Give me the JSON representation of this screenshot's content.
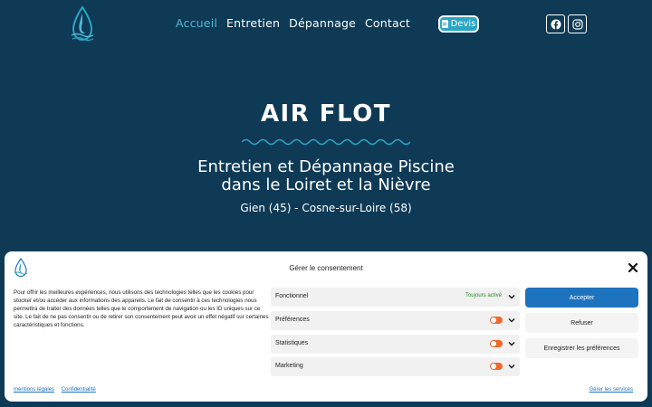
{
  "nav": {
    "items": [
      {
        "label": "Accueil",
        "active": true
      },
      {
        "label": "Entretien",
        "active": false
      },
      {
        "label": "Dépannage",
        "active": false
      },
      {
        "label": "Contact",
        "active": false
      }
    ],
    "devis_label": "Devis",
    "active_color": "#4fb8d4"
  },
  "hero": {
    "title": "AIR FLOT",
    "subtitle_line1": "Entretien et Dépannage Piscine",
    "subtitle_line2": "dans le Loiret et la Nièvre",
    "locations": "Gien (45) - Cosne-sur-Loire (58)"
  },
  "consent": {
    "title": "Gérer le consentement",
    "description": "Pour offrir les meilleures expériences, nous utilisons des technologies telles que les cookies pour stocker et/ou accéder aux informations des appareils. Le fait de consentir à ces technologies nous permettra de traiter des données telles que le comportement de navigation ou les ID uniques sur ce site. Le fait de ne pas consentir ou de retirer son consentement peut avoir un effet négatif sur certaines caractéristiques et fonctions.",
    "categories": [
      {
        "label": "Fonctionnel",
        "status": "Toujours activé"
      },
      {
        "label": "Préférences",
        "status": ""
      },
      {
        "label": "Statistiques",
        "status": ""
      },
      {
        "label": "Marketing",
        "status": ""
      }
    ],
    "accept_label": "Accepter",
    "refuse_label": "Refuser",
    "save_prefs_label": "Enregistrer les préférences",
    "links": [
      "mentions légales",
      "Confidentialité"
    ],
    "manage_services": "Gérer les services",
    "accent_color": "#1e73be",
    "toggle_color": "#ef6a2a"
  },
  "colors": {
    "background": "#0e3a56",
    "devis_button": "#2aa5c4"
  }
}
